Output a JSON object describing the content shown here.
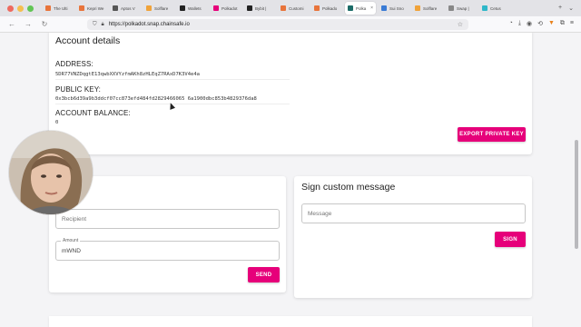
{
  "browser": {
    "tabs": [
      {
        "label": "The Ulti",
        "color": "#e8743b"
      },
      {
        "label": "Kepri We",
        "color": "#e8743b"
      },
      {
        "label": "Aptos V",
        "color": "#555555"
      },
      {
        "label": "Solflare",
        "color": "#f0a33a"
      },
      {
        "label": "Wallets",
        "color": "#222222"
      },
      {
        "label": "Polkadot",
        "color": "#e6007a"
      },
      {
        "label": "Bybit |",
        "color": "#222222"
      },
      {
        "label": "Customi",
        "color": "#e8743b"
      },
      {
        "label": "Polkado",
        "color": "#e8743b"
      },
      {
        "label": "Polka",
        "color": "#1c6c68",
        "active": true
      },
      {
        "label": "Sui Sno",
        "color": "#3a7bd5"
      },
      {
        "label": "Solflare",
        "color": "#f0a33a"
      },
      {
        "label": "Swap |",
        "color": "#888888"
      },
      {
        "label": "Cetus",
        "color": "#2fb7c9"
      }
    ],
    "url_host": "https://polkadot.snap.chainsafe.io",
    "back_icon": "arrow-left-icon",
    "forward_icon": "arrow-right-icon",
    "reload_icon": "reload-icon"
  },
  "account": {
    "title": "Account details",
    "address_label": "ADDRESS:",
    "address_value": "5DR77VNZDqgtE13qwbXXVYzfmAKh8zHLEqZ7RAxD7K3V4e4a",
    "public_key_label": "PUBLIC KEY:",
    "public_key_value": "0x3bcb6d39a9b3ddcf07cc873efd484fd2829466065 6a1900dbc853b4829376da8",
    "balance_label": "ACCOUNT BALANCE:",
    "balance_value": "0",
    "export_button": "EXPORT PRIVATE KEY"
  },
  "transfer": {
    "title": "er",
    "recipient_placeholder": "Recipient",
    "amount_label": "Amount",
    "amount_value": "mWND",
    "send_button": "SEND"
  },
  "sign": {
    "title": "Sign custom message",
    "message_placeholder": "Message",
    "sign_button": "SIGN"
  },
  "colors": {
    "accent": "#e6007a",
    "page_bg": "#f4f4f6"
  }
}
